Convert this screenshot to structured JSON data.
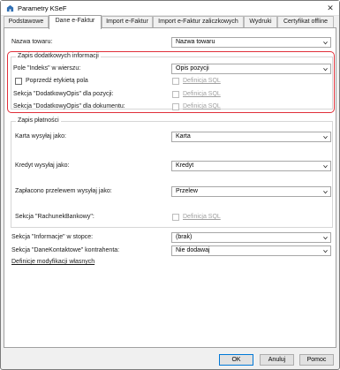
{
  "window": {
    "title": "Parametry KSeF",
    "close_glyph": "✕"
  },
  "tabs": [
    {
      "label": "Podstawowe"
    },
    {
      "label": "Dane e-Faktur"
    },
    {
      "label": "Import e-Faktur"
    },
    {
      "label": "Import e-Faktur zaliczkowych"
    },
    {
      "label": "Wydruki"
    },
    {
      "label": "Certyfikat offline"
    }
  ],
  "main": {
    "nazwa_towaru": {
      "label": "Nazwa towaru:",
      "value": "Nazwa towaru"
    },
    "zapis_dodatkowych": {
      "title": "Zapis dodatkowych informacji",
      "pole_indeks": {
        "label": "Pole \"Indeks\" w wierszu:",
        "value": "Opis pozycji"
      },
      "poprzedz": {
        "label": "Poprzedź etykietą pola"
      },
      "definicja_sql_label": "Definicja SQL",
      "sekcja_pozycji": {
        "label": "Sekcja \"DodatkowyOpis\" dla pozycji:"
      },
      "sekcja_dokumentu": {
        "label": "Sekcja \"DodatkowyOpis\" dla dokumentu:"
      }
    },
    "zapis_platnosci": {
      "title": "Zapis płatności",
      "karta": {
        "label": "Karta wysyłaj jako:",
        "value": "Karta"
      },
      "kredyt": {
        "label": "Kredyt wysyłaj jako:",
        "value": "Kredyt"
      },
      "przelew": {
        "label": "Zapłacono przelewem wysyłaj jako:",
        "value": "Przelew"
      },
      "rachunek": {
        "label": "Sekcja \"RachunekBankowy\":",
        "link": "Definicja SQL"
      }
    },
    "informacje_stopce": {
      "label": "Sekcja \"Informacje\" w stopce:",
      "value": "(brak)"
    },
    "dane_kontaktowe": {
      "label": "Sekcja \"DaneKontaktowe\" kontrahenta:",
      "value": "Nie dodawaj"
    },
    "definicje_link": "Definicje modyfikacji własnych"
  },
  "footer": {
    "ok": "OK",
    "cancel": "Anuluj",
    "help": "Pomoc"
  },
  "colors": {
    "highlight": "#e0303a",
    "primary_border": "#0078d7"
  },
  "icons": [
    "app-icon",
    "close-icon",
    "chevron-down-icon"
  ]
}
